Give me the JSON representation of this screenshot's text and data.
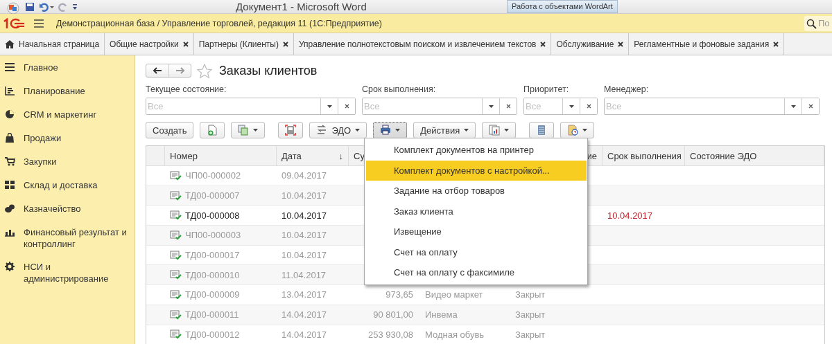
{
  "word_titlebar": {
    "title": "Документ1 - Microsoft Word",
    "context_tab": "Работа с объектами WordArt"
  },
  "app_header": {
    "title": "Демонстрационная база / Управление торговлей, редакция 11  (1С:Предприятие)",
    "search": {
      "placeholder": "По"
    }
  },
  "tabs": [
    {
      "label": "Начальная страница",
      "kind": "home"
    },
    {
      "label": "Общие настройки",
      "kind": "page"
    },
    {
      "label": "Партнеры (Клиенты)",
      "kind": "page"
    },
    {
      "label": "Управление полнотекстовым поиском и извлечением текстов",
      "kind": "page"
    },
    {
      "label": "Обслуживание",
      "kind": "page"
    },
    {
      "label": "Регламентные и фоновые задания",
      "kind": "page"
    }
  ],
  "sidebar": {
    "items": [
      {
        "label": "Главное"
      },
      {
        "label": "Планирование"
      },
      {
        "label": "CRM и маркетинг"
      },
      {
        "label": "Продажи"
      },
      {
        "label": "Закупки"
      },
      {
        "label": "Склад и доставка"
      },
      {
        "label": "Казначейство"
      },
      {
        "label": "Финансовый результат и контроллинг"
      },
      {
        "label": "НСИ и администрирование"
      }
    ]
  },
  "form": {
    "title": "Заказы клиентов",
    "filters": [
      {
        "label": "Текущее состояние:",
        "placeholder": "Все"
      },
      {
        "label": "Срок выполнения:",
        "placeholder": "Все"
      },
      {
        "label": "Приоритет:",
        "placeholder": "Все"
      },
      {
        "label": "Менеджер:",
        "placeholder": "Все"
      }
    ],
    "toolbar": [
      {
        "kind": "text",
        "label": "Создать",
        "dropdown": false,
        "pressed": false
      },
      {
        "kind": "icon",
        "dropdown": false,
        "pressed": false
      },
      {
        "kind": "icon",
        "dropdown": true,
        "pressed": false
      },
      {
        "kind": "icon",
        "dropdown": false,
        "pressed": false
      },
      {
        "kind": "text",
        "label": "ЭДО",
        "dropdown": true,
        "pressed": false
      },
      {
        "kind": "icon",
        "dropdown": true,
        "pressed": true
      },
      {
        "kind": "text",
        "label": "Действия",
        "dropdown": true,
        "pressed": false
      },
      {
        "kind": "icon",
        "dropdown": true,
        "pressed": false
      },
      {
        "kind": "icon",
        "dropdown": false,
        "pressed": false
      },
      {
        "kind": "icon",
        "dropdown": true,
        "pressed": false
      }
    ],
    "print_menu": [
      {
        "label": "Комплект документов на принтер",
        "selected": false
      },
      {
        "label": "Комплект документов с настройкой...",
        "selected": true
      },
      {
        "label": "Задание на отбор товаров",
        "selected": false
      },
      {
        "label": "Заказ клиента",
        "selected": false
      },
      {
        "label": "Извещение",
        "selected": false
      },
      {
        "label": "Счет на оплату",
        "selected": false
      },
      {
        "label": "Счет на оплату с факсимиле",
        "selected": false
      }
    ],
    "table": {
      "columns": [
        {
          "label": "Номер"
        },
        {
          "label": "Дата",
          "sort_mark": "↓"
        },
        {
          "label": "Су"
        },
        {},
        {
          "label": "ие"
        },
        {
          "label": "Срок выполнения"
        },
        {
          "label": "Состояние ЭДО"
        }
      ],
      "rows": [
        {
          "number": "ЧП00-000002",
          "date": "09.04.2017",
          "closed": true
        },
        {
          "number": "ТД00-000007",
          "date": "10.04.2017",
          "closed": true
        },
        {
          "number": "ТД00-000008",
          "date": "10.04.2017",
          "closed": false,
          "due": "10.04.2017"
        },
        {
          "number": "ЧП00-000003",
          "date": "10.04.2017",
          "closed": true
        },
        {
          "number": "ТД00-000017",
          "date": "10.04.2017",
          "closed": true
        },
        {
          "number": "ТД00-000010",
          "date": "11.04.2017",
          "closed": true
        },
        {
          "number": "ТД00-000009",
          "date": "13.04.2017",
          "sum": "973,65",
          "client": "Видео маркет",
          "status": "Закрыт",
          "closed": true
        },
        {
          "number": "ТД00-000011",
          "date": "14.04.2017",
          "sum": "90 801,00",
          "client": "Инвема",
          "status": "Закрыт",
          "closed": true
        },
        {
          "number": "ТД00-000012",
          "date": "14.04.2017",
          "sum": "253 930,08",
          "client": "Модная обувь",
          "status": "Закрыт",
          "closed": true
        }
      ]
    }
  }
}
